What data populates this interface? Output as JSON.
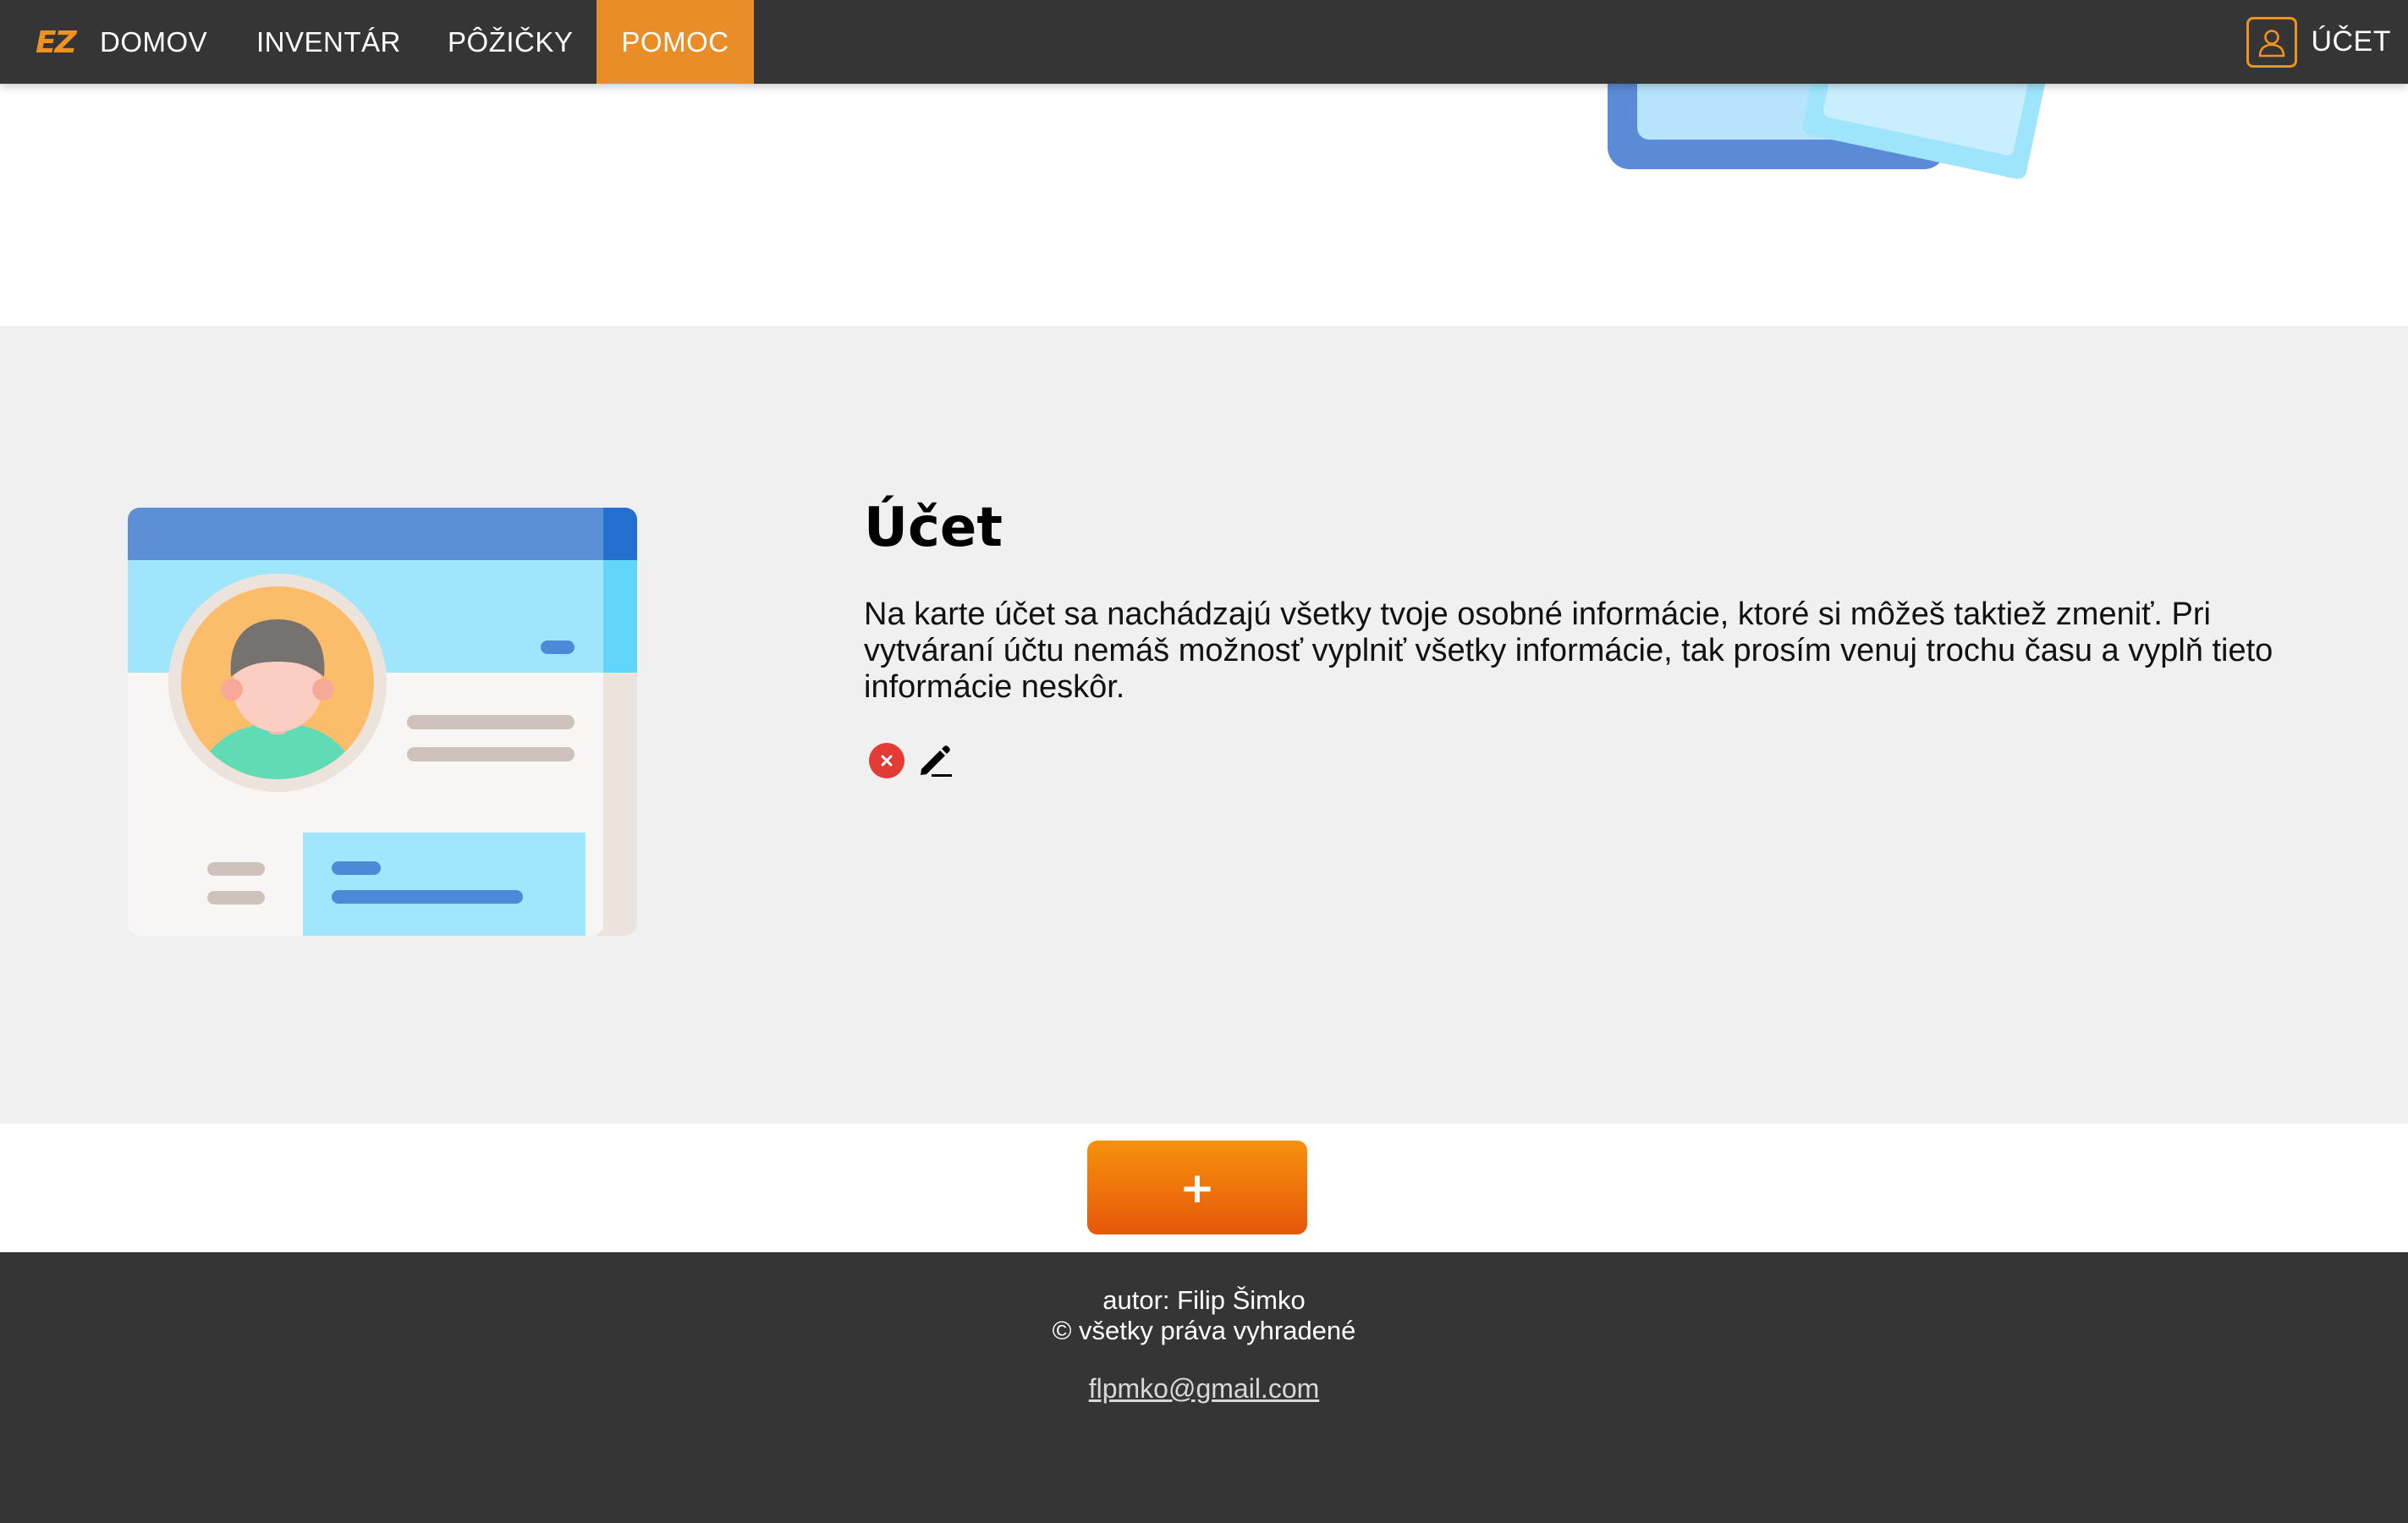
{
  "nav": {
    "items": [
      {
        "label": "DOMOV"
      },
      {
        "label": "INVENTÁR"
      },
      {
        "label": "PÔŽIČKY"
      },
      {
        "label": "POMOC"
      }
    ],
    "active": "POMOC",
    "account_label": "ÚČET"
  },
  "help": {
    "title": "Účet",
    "text": "Na karte účet sa nachádzajú všetky tvoje osobné informácie, ktoré si môžeš taktiež zmeniť. Pri vytváraní účtu nemáš možnosť vyplniť všetky informácie, tak prosím venuj trochu času a vyplň tieto informácie neskôr.",
    "icons": [
      "delete-icon",
      "edit-icon"
    ]
  },
  "add_button": {
    "label": "+"
  },
  "footer": {
    "author": "autor: Filip Šimko",
    "rights": "© všetky práva vyhradené",
    "email": "flpmko@gmail.com"
  },
  "colors": {
    "nav_bg": "#353535",
    "accent": "#e88d27",
    "section_bg": "#f0f0f0",
    "button_gradient": [
      "#f7920c",
      "#e5570a"
    ],
    "delete": "#e33b36"
  }
}
